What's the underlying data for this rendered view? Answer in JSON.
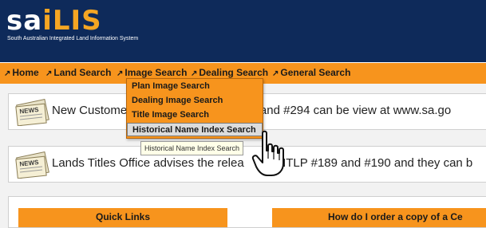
{
  "brand": {
    "logo_prefix": "sa",
    "logo_accent": "iLIS",
    "tagline": "South Australian Integrated Land Information System"
  },
  "nav": {
    "items": [
      {
        "label": "Home"
      },
      {
        "label": "Land Search"
      },
      {
        "label": "Image Search"
      },
      {
        "label": "Dealing Search"
      },
      {
        "label": "General Search"
      }
    ]
  },
  "dropdown": {
    "items": [
      {
        "label": "Plan Image Search"
      },
      {
        "label": "Dealing Image Search"
      },
      {
        "label": "Title Image Search"
      },
      {
        "label": "Historical Name Index Search"
      }
    ],
    "active_index": 3
  },
  "tooltip": {
    "text": "Historical Name Index Search"
  },
  "news": [
    {
      "text": "New Custome                                 293 and #294 can be view at www.sa.go"
    },
    {
      "text": "Lands Titles Office advises the relea          NTLP #189 and #190 and they can b"
    }
  ],
  "panels": {
    "quick_links": "Quick Links",
    "order_copy": "How do I order a copy of a Ce"
  },
  "colors": {
    "header_bg": "#0e2a5a",
    "nav_bg": "#f7941d",
    "logo_accent": "#f5a623",
    "active_item_bg": "#dcdcdc"
  },
  "icons": {
    "news": "newspaper-icon",
    "cursor": "hand-pointer-icon",
    "nav_arrow": "arrow-northeast-icon"
  }
}
